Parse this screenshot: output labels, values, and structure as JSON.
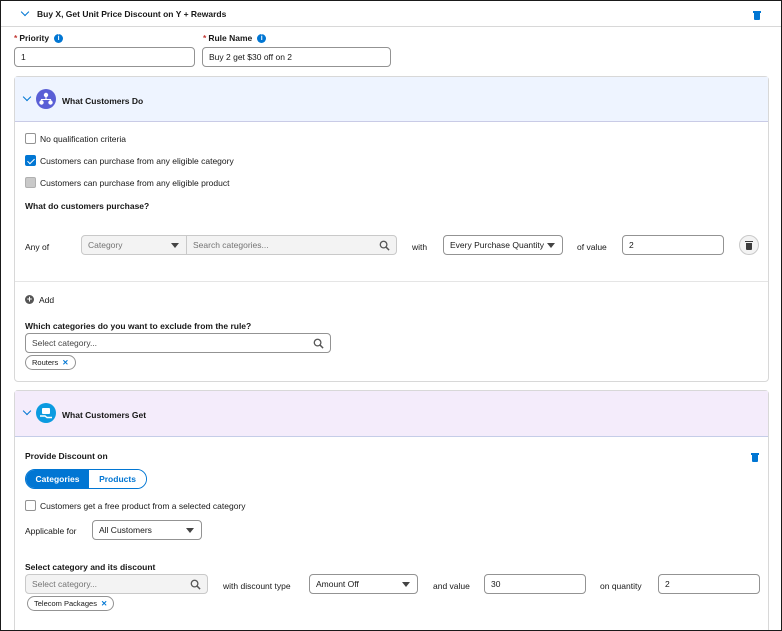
{
  "rule": {
    "title": "Buy X, Get Unit Price Discount on Y + Rewards"
  },
  "fields": {
    "priority_label": "Priority",
    "priority_value": "1",
    "rule_name_label": "Rule Name",
    "rule_name_value": "Buy 2 get $30 off on 2"
  },
  "what_customers_do": {
    "title": "What Customers Do",
    "checkboxes": [
      {
        "label": "No qualification criteria",
        "state": "unchecked"
      },
      {
        "label": "Customers can purchase from any eligible category",
        "state": "checked"
      },
      {
        "label": "Customers can purchase from any eligible product",
        "state": "disabled"
      }
    ],
    "purchase_question": "What do customers purchase?",
    "any_of_label": "Any of",
    "type_select": "Category",
    "search_placeholder": "Search categories...",
    "with_label": "with",
    "quantity_select": "Every Purchase Quantity",
    "of_value_label": "of value",
    "value": "2",
    "add_label": "Add",
    "exclude_question": "Which categories do you want to exclude from the rule?",
    "exclude_placeholder": "Select category...",
    "excluded_pill": "Routers"
  },
  "what_customers_get": {
    "title": "What Customers Get",
    "provide_label": "Provide Discount on",
    "tabs": [
      "Categories",
      "Products"
    ],
    "active_tab": "Categories",
    "free_product_label": "Customers get a free product from a selected category",
    "applicable_label": "Applicable for",
    "applicable_value": "All Customers",
    "select_discount_label": "Select category and its discount",
    "category_placeholder": "Select category...",
    "discount_type_label": "with discount type",
    "discount_type_value": "Amount Off",
    "and_value_label": "and value",
    "discount_value": "30",
    "on_quantity_label": "on quantity",
    "quantity_value": "2",
    "category_pill": "Telecom Packages"
  },
  "colors": {
    "accent": "#0176d3",
    "section_do_bg": "#eef4ff",
    "section_get_bg": "#f4ecfb",
    "required": "#c23934"
  }
}
